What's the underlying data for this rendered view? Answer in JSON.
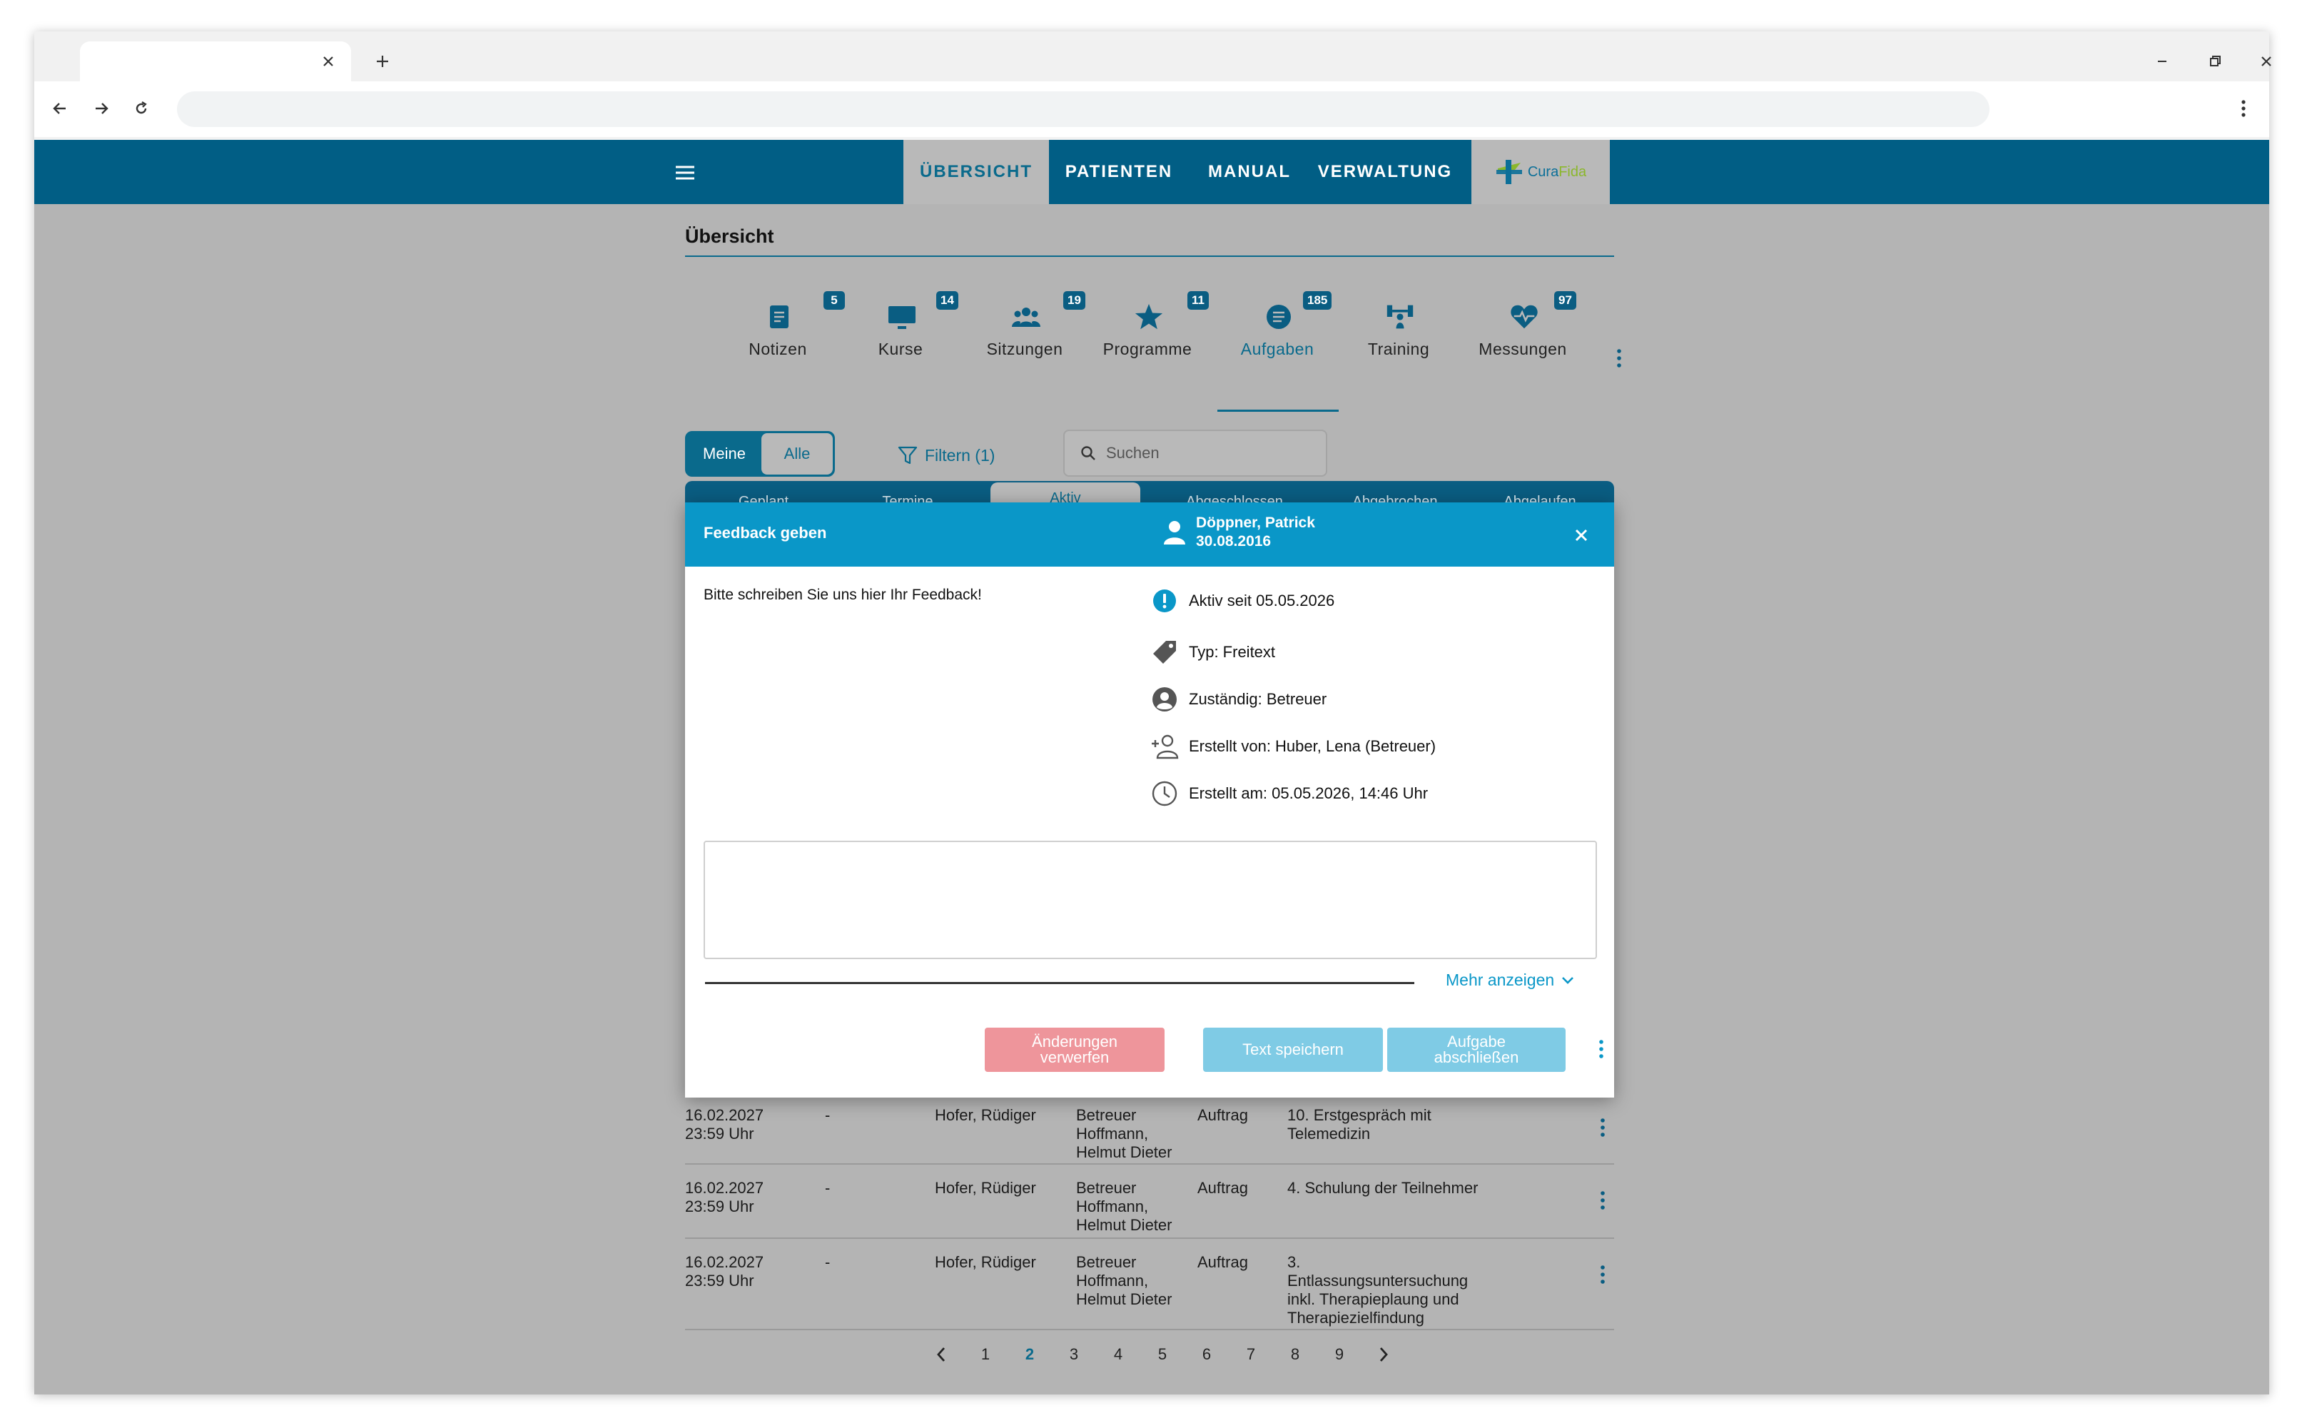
{
  "browser": {
    "tab_title": "",
    "address": ""
  },
  "nav": {
    "tabs": [
      {
        "label": "ÜBERSICHT",
        "active": true
      },
      {
        "label": "PATIENTEN",
        "active": false
      },
      {
        "label": "MANUAL",
        "active": false
      },
      {
        "label": "VERWALTUNG",
        "active": false
      }
    ],
    "logo": {
      "part1": "Cura",
      "part2": "Fida"
    }
  },
  "page": {
    "title": "Übersicht"
  },
  "categories": [
    {
      "label": "Notizen",
      "badge": "5",
      "icon": "note-icon"
    },
    {
      "label": "Kurse",
      "badge": "14",
      "icon": "monitor-icon"
    },
    {
      "label": "Sitzungen",
      "badge": "19",
      "icon": "group-icon"
    },
    {
      "label": "Programme",
      "badge": "11",
      "icon": "star-icon"
    },
    {
      "label": "Aufgaben",
      "badge": "185",
      "icon": "list-icon",
      "active": true
    },
    {
      "label": "Training",
      "badge": "",
      "icon": "dumbbell-icon"
    },
    {
      "label": "Messungen",
      "badge": "97",
      "icon": "heart-pulse-icon"
    }
  ],
  "filters": {
    "meine": "Meine",
    "alle": "Alle",
    "filter_label": "Filtern (1)",
    "search_placeholder": "Suchen"
  },
  "subtabs": [
    {
      "label": "Geplant"
    },
    {
      "label": "Termine"
    },
    {
      "label": "Aktiv",
      "active": true
    },
    {
      "label": "Abgeschlossen"
    },
    {
      "label": "Abgebrochen"
    },
    {
      "label": "Abgelaufen"
    }
  ],
  "rows": [
    {
      "date": "16.02.2027",
      "time": "23:59 Uhr",
      "dash": "-",
      "patient": "Hofer, Rüdiger",
      "resp1": "Betreuer",
      "resp2": "Hoffmann,",
      "resp3": "Helmut Dieter",
      "type": "Auftrag",
      "title": [
        "10. Erstgespräch mit",
        "Telemedizin"
      ]
    },
    {
      "date": "16.02.2027",
      "time": "23:59 Uhr",
      "dash": "-",
      "patient": "Hofer, Rüdiger",
      "resp1": "Betreuer",
      "resp2": "Hoffmann,",
      "resp3": "Helmut Dieter",
      "type": "Auftrag",
      "title": [
        "4. Schulung der Teilnehmer"
      ]
    },
    {
      "date": "16.02.2027",
      "time": "23:59 Uhr",
      "dash": "-",
      "patient": "Hofer, Rüdiger",
      "resp1": "Betreuer",
      "resp2": "Hoffmann,",
      "resp3": "Helmut Dieter",
      "type": "Auftrag",
      "title": [
        "3.",
        "Entlassungsuntersuchung",
        "inkl. Therapieplaung und",
        "Therapiezielfindung"
      ]
    }
  ],
  "pagination": {
    "pages": [
      "1",
      "2",
      "3",
      "4",
      "5",
      "6",
      "7",
      "8",
      "9"
    ],
    "current": "2"
  },
  "modal": {
    "title": "Feedback geben",
    "patient_name": "Döppner, Patrick",
    "patient_dob": "30.08.2016",
    "prompt": "Bitte schreiben Sie uns hier Ihr Feedback!",
    "info": {
      "active_since": "Aktiv seit 05.05.2026",
      "type": "Typ: Freitext",
      "responsible": "Zuständig: Betreuer",
      "created_by": "Erstellt von: Huber, Lena (Betreuer)",
      "created_at": "Erstellt am: 05.05.2026, 14:46 Uhr"
    },
    "textarea_value": "",
    "more_label": "Mehr anzeigen",
    "buttons": {
      "discard": "Änderungen verwerfen",
      "save": "Text speichern",
      "complete": "Aufgabe abschließen"
    }
  },
  "colors": {
    "appbar": "#015e85",
    "modal_header": "#0a97c8",
    "accent": "#0a6a8c",
    "discard": "#ee959b",
    "save": "#7fcbe5",
    "overlay": "#b4b4b4"
  }
}
